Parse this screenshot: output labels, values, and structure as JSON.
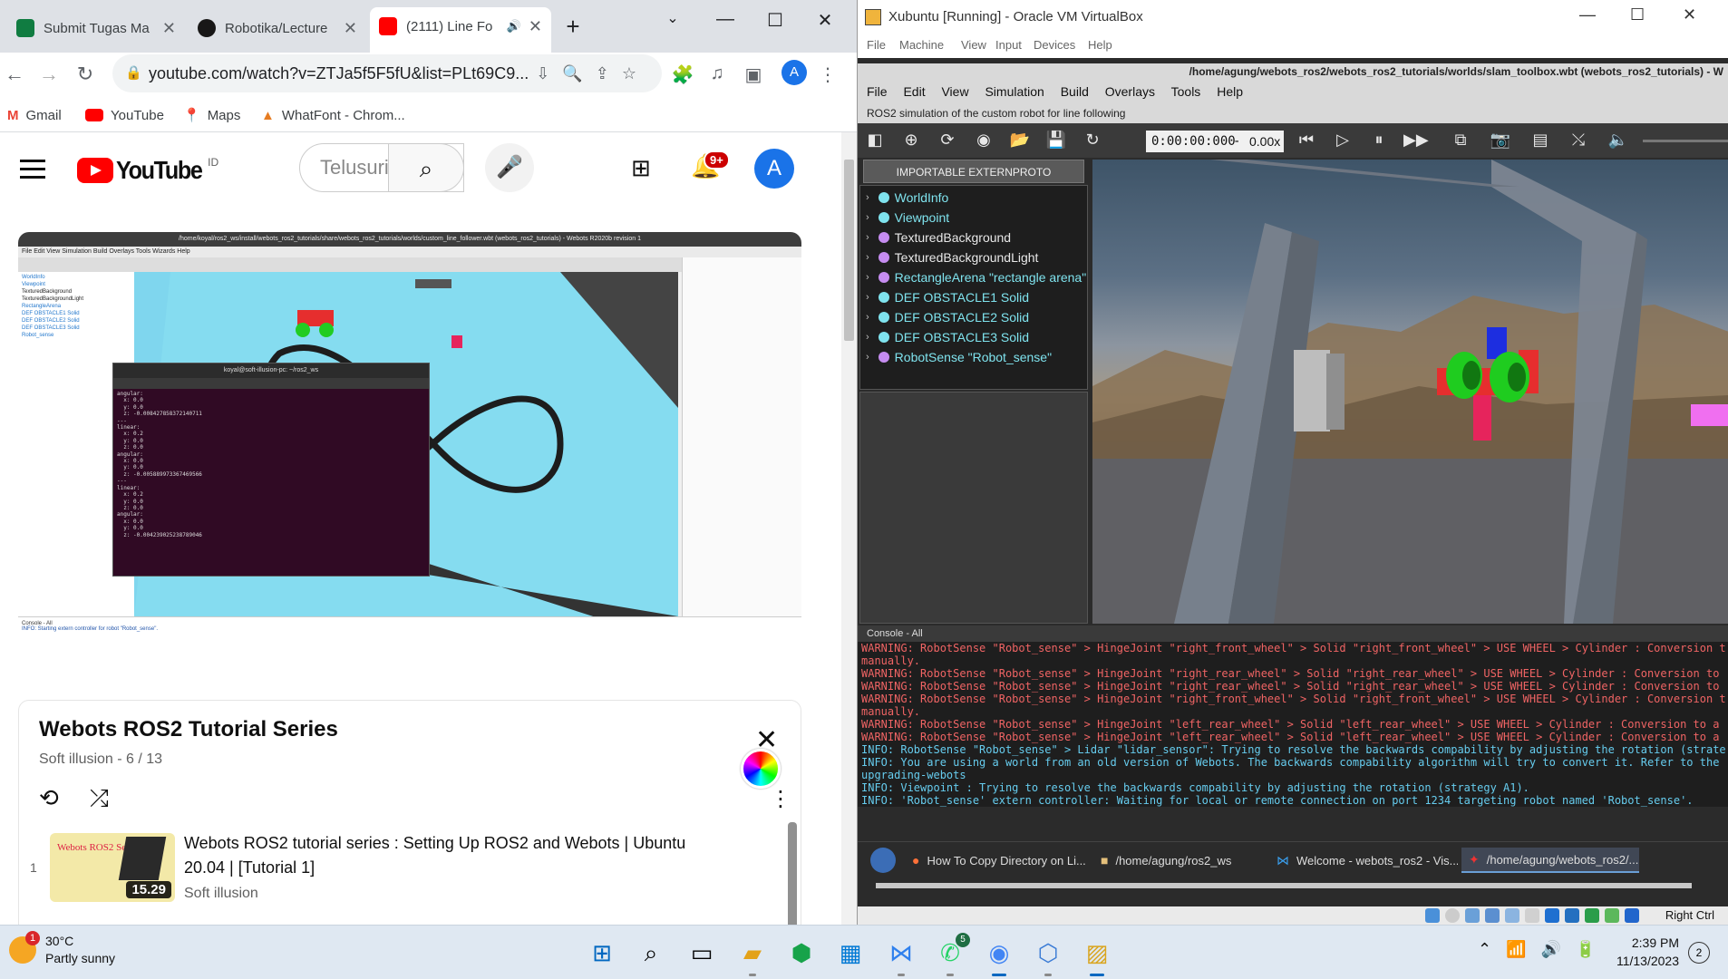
{
  "chrome": {
    "tabs": [
      {
        "title": "Submit Tugas Ma",
        "icon": "excel-icon",
        "color": "#107c41"
      },
      {
        "title": "Robotika/Lecture",
        "icon": "github-icon",
        "color": "#181717"
      },
      {
        "title": "(2111) Line Fo",
        "icon": "youtube-icon",
        "color": "#ff0000"
      }
    ],
    "new_tab_label": "+",
    "url": "youtube.com/watch?v=ZTJa5f5F5fU&list=PLt69C9...",
    "profile_initial": "A",
    "bookmarks": [
      {
        "label": "Gmail",
        "icon": "gmail-icon"
      },
      {
        "label": "YouTube",
        "icon": "youtube-icon"
      },
      {
        "label": "Maps",
        "icon": "maps-icon"
      },
      {
        "label": "WhatFont - Chrom...",
        "icon": "whatfont-icon"
      }
    ]
  },
  "youtube": {
    "logo_text": "YouTube",
    "country_code": "ID",
    "search_placeholder": "Telusuri",
    "notification_count": "9+",
    "avatar_initial": "A",
    "playlist": {
      "title": "Webots ROS2 Tutorial Series",
      "subtitle": "Soft illusion - 6 / 13",
      "items": [
        {
          "index": "1",
          "title": "Webots ROS2 tutorial series : Setting Up ROS2 and Webots | Ubuntu 20.04 | [Tutorial 1]",
          "channel": "Soft illusion",
          "duration": "15.29",
          "thumb_text": "Webots ROS2 Series"
        }
      ]
    },
    "video": {
      "window_title": "/home/koyal/ros2_ws/install/webots_ros2_tutorials/share/webots_ros2_tutorials/worlds/custom_line_follower.wbt (webots_ros2_tutorials) - Webots R2020b revision 1",
      "menu": "File  Edit  View  Simulation  Build  Overlays  Tools  Wizards  Help",
      "tree": [
        "WorldInfo",
        "Viewpoint",
        "TexturedBackground",
        "TexturedBackgroundLight",
        "RectangleArena",
        "DEF OBSTACLE1 Solid",
        "DEF OBSTACLE2 Solid",
        "DEF OBSTACLE3 Solid",
        "Robot_sense"
      ],
      "terminal_title": "koyal@soft-illusion-pc: ~/ros2_ws",
      "terminal_text": "angular:\n  x: 0.0\n  y: 0.0\n  z: -0.008427858372140711\n---\nlinear:\n  x: 0.2\n  y: 0.0\n  z: 0.0\nangular:\n  x: 0.0\n  y: 0.0\n  z: -0.005889973367469566\n---\nlinear:\n  x: 0.2\n  y: 0.0\n  z: 0.0\nangular:\n  x: 0.0\n  y: 0.0\n  z: -0.004239025238789046",
      "console_label": "Console - All",
      "console_text": "INFO: Starting extern controller for robot \"Robot_sense\"."
    }
  },
  "virtualbox": {
    "title": "Xubuntu [Running] - Oracle VM VirtualBox",
    "menu": [
      "File",
      "Machine",
      "View",
      "Input",
      "Devices",
      "Help"
    ],
    "right_ctrl": "Right Ctrl"
  },
  "webots": {
    "window_title": "/home/agung/webots_ros2/webots_ros2_tutorials/worlds/slam_toolbox.wbt (webots_ros2_tutorials) - W",
    "menu": [
      "File",
      "Edit",
      "View",
      "Simulation",
      "Build",
      "Overlays",
      "Tools",
      "Help"
    ],
    "description": "ROS2 simulation of the custom robot for line following",
    "time": "0:00:00:000",
    "speed": "0.00x",
    "externproto_label": "IMPORTABLE EXTERNPROTO",
    "scene_tree": [
      {
        "label": "WorldInfo",
        "dot": "#7fe3ee",
        "cyan": true
      },
      {
        "label": "Viewpoint",
        "dot": "#7fe3ee",
        "cyan": true
      },
      {
        "label": "TexturedBackground",
        "dot": "#c58cf0",
        "cyan": false
      },
      {
        "label": "TexturedBackgroundLight",
        "dot": "#c58cf0",
        "cyan": false
      },
      {
        "label": "RectangleArena \"rectangle arena\"",
        "dot": "#c58cf0",
        "cyan": true
      },
      {
        "label": "DEF OBSTACLE1 Solid",
        "dot": "#7fe3ee",
        "cyan": true
      },
      {
        "label": "DEF OBSTACLE2 Solid",
        "dot": "#7fe3ee",
        "cyan": true
      },
      {
        "label": "DEF OBSTACLE3 Solid",
        "dot": "#7fe3ee",
        "cyan": true
      },
      {
        "label": "RobotSense \"Robot_sense\"",
        "dot": "#c58cf0",
        "cyan": true
      }
    ],
    "console_label": "Console - All",
    "console_lines": [
      {
        "t": "warn",
        "text": "WARNING: RobotSense \"Robot_sense\" > HingeJoint \"right_front_wheel\" > Solid \"right_front_wheel\" > USE WHEEL > Cylinder : Conversion to"
      },
      {
        "t": "warn",
        "text": "manually."
      },
      {
        "t": "warn",
        "text": "WARNING: RobotSense \"Robot_sense\" > HingeJoint \"right_rear_wheel\" > Solid \"right_rear_wheel\" > USE WHEEL > Cylinder : Conversion to a"
      },
      {
        "t": "warn",
        "text": "WARNING: RobotSense \"Robot_sense\" > HingeJoint \"right_rear_wheel\" > Solid \"right_rear_wheel\" > USE WHEEL > Cylinder : Conversion to a"
      },
      {
        "t": "warn",
        "text": "WARNING: RobotSense \"Robot_sense\" > HingeJoint \"right_front_wheel\" > Solid \"right_front_wheel\" > USE WHEEL > Cylinder : Conversion to"
      },
      {
        "t": "warn",
        "text": "manually."
      },
      {
        "t": "warn",
        "text": "WARNING: RobotSense \"Robot_sense\" > HingeJoint \"left_rear_wheel\" > Solid \"left_rear_wheel\" > USE WHEEL > Cylinder : Conversion to a"
      },
      {
        "t": "warn",
        "text": "WARNING: RobotSense \"Robot_sense\" > HingeJoint \"left_rear_wheel\" > Solid \"left_rear_wheel\" > USE WHEEL > Cylinder : Conversion to a"
      },
      {
        "t": "info",
        "text": "INFO: RobotSense \"Robot_sense\" > Lidar \"lidar_sensor\": Trying to resolve the backwards compability by adjusting the rotation (strategy"
      },
      {
        "t": "info",
        "text": "INFO: You are using a world from an old version of Webots. The backwards compability algorithm will try to convert it. Refer to the"
      },
      {
        "t": "info",
        "text": "upgrading-webots"
      },
      {
        "t": "info",
        "text": "INFO: Viewpoint : Trying to resolve the backwards compability by adjusting the rotation (strategy A1)."
      },
      {
        "t": "info",
        "text": "INFO: 'Robot_sense' extern controller: Waiting for local or remote connection on port 1234 targeting robot named 'Robot_sense'."
      }
    ],
    "taskbar": [
      {
        "label": "How To Copy Directory on Li...",
        "icon": "firefox-icon"
      },
      {
        "label": "/home/agung/ros2_ws",
        "icon": "folder-icon"
      },
      {
        "label": "Welcome - webots_ros2 - Vis...",
        "icon": "vscode-icon"
      },
      {
        "label": "/home/agung/webots_ros2/...",
        "icon": "webots-icon"
      }
    ]
  },
  "windows": {
    "weather_temp": "30°C",
    "weather_desc": "Partly sunny",
    "weather_badge": "1",
    "time": "2:39 PM",
    "date": "11/13/2023",
    "notifications": "2",
    "whatsapp_badge": "5"
  }
}
